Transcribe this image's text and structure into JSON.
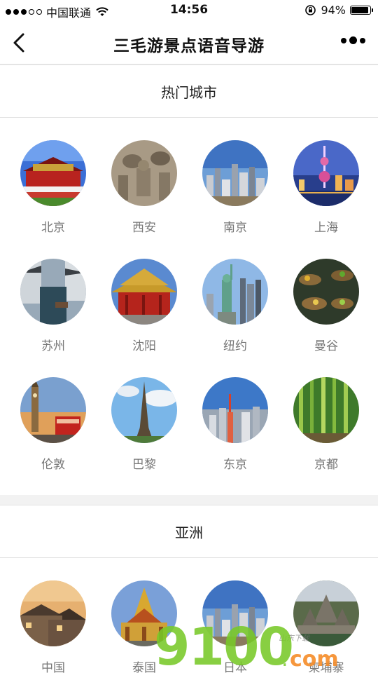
{
  "status_bar": {
    "carrier": "中国联通",
    "time": "14:56",
    "battery": "94%",
    "battery_level": 0.94,
    "signal_bars_filled": 3,
    "signal_bars_total": 5
  },
  "nav": {
    "title": "三毛游景点语音导游",
    "back_icon": "chevron-left-icon",
    "more_icon": "more-dots-icon"
  },
  "sections": [
    {
      "title": "热门城市",
      "cities": [
        {
          "name": "北京",
          "icon": "tiananmen"
        },
        {
          "name": "西安",
          "icon": "terracotta-warriors"
        },
        {
          "name": "南京",
          "icon": "city-skyline"
        },
        {
          "name": "上海",
          "icon": "oriental-pearl-tower"
        },
        {
          "name": "苏州",
          "icon": "water-town-canal"
        },
        {
          "name": "沈阳",
          "icon": "imperial-palace"
        },
        {
          "name": "纽约",
          "icon": "statue-of-liberty"
        },
        {
          "name": "曼谷",
          "icon": "floating-market"
        },
        {
          "name": "伦敦",
          "icon": "big-ben"
        },
        {
          "name": "巴黎",
          "icon": "eiffel-tower"
        },
        {
          "name": "东京",
          "icon": "tokyo-skyline"
        },
        {
          "name": "京都",
          "icon": "bamboo-forest"
        }
      ]
    },
    {
      "title": "亚洲",
      "cities": [
        {
          "name": "中国",
          "icon": "ancient-town"
        },
        {
          "name": "泰国",
          "icon": "thai-temple"
        },
        {
          "name": "日本",
          "icon": "city-skyline"
        },
        {
          "name": "柬埔寨",
          "icon": "angkor-temple"
        }
      ]
    }
  ],
  "watermark": {
    "main": "9100",
    "dot": ".",
    "suffix": "com",
    "sub": "山东下载"
  },
  "colors": {
    "background": "#ffffff",
    "divider": "#e2e2e2",
    "section_gap": "#f2f2f2",
    "label": "#777777"
  }
}
